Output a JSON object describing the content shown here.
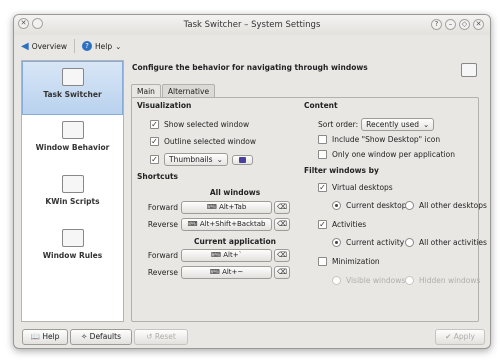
{
  "window": {
    "title": "Task Switcher – System Settings",
    "controls": [
      "?",
      "–",
      "◇",
      "✕"
    ]
  },
  "toolbar": {
    "overview_label": "Overview",
    "help_label": "Help"
  },
  "sidebar": {
    "items": [
      {
        "label": "Task Switcher"
      },
      {
        "label": "Window Behavior"
      },
      {
        "label": "KWin Scripts"
      },
      {
        "label": "Window Rules"
      }
    ]
  },
  "main": {
    "heading": "Configure the behavior for navigating through windows",
    "tabs": [
      {
        "label": "Main"
      },
      {
        "label": "Alternative"
      }
    ],
    "visualization": {
      "title": "Visualization",
      "show_selected": "Show selected window",
      "outline_selected": "Outline selected window",
      "effect_value": "Thumbnails"
    },
    "shortcuts": {
      "title": "Shortcuts",
      "all_windows": "All windows",
      "forward_label": "Forward",
      "forward_key": "Alt+Tab",
      "reverse_label": "Reverse",
      "reverse_key": "Alt+Shift+Backtab",
      "current_app": "Current application",
      "cur_forward_label": "Forward",
      "cur_forward_key": "Alt+`",
      "cur_reverse_label": "Reverse",
      "cur_reverse_key": "Alt+~"
    },
    "content": {
      "title": "Content",
      "sort_order_label": "Sort order:",
      "sort_order_value": "Recently used",
      "include_desktop": "Include \"Show Desktop\" icon",
      "one_per_app": "Only one window per application"
    },
    "filter": {
      "title": "Filter windows by",
      "virtual_desktops": "Virtual desktops",
      "current_desktop": "Current desktop",
      "all_other_desktops": "All other desktops",
      "activities": "Activities",
      "current_activity": "Current activity",
      "all_other_activities": "All other activities",
      "minimization": "Minimization",
      "visible_windows": "Visible windows",
      "hidden_windows": "Hidden windows"
    }
  },
  "bottom": {
    "help": "Help",
    "defaults": "Defaults",
    "reset": "Reset",
    "apply": "Apply"
  }
}
